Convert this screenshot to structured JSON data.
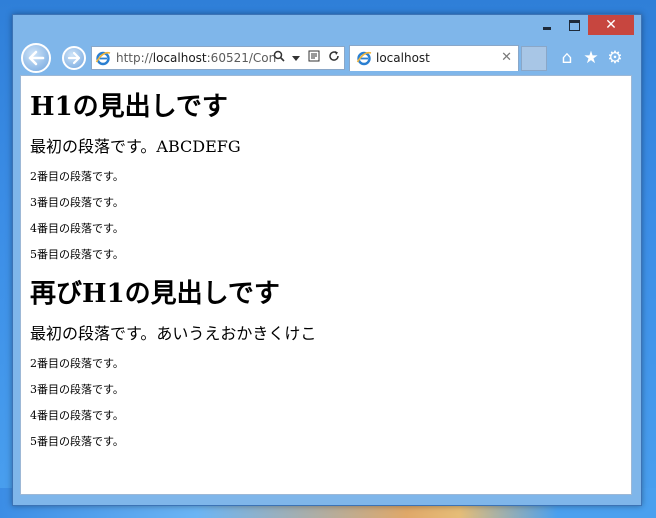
{
  "window": {
    "minimize_label": "",
    "maximize_label": "",
    "close_label": "✕"
  },
  "toolbar": {
    "address_prefix": "http://",
    "address_host": "localhost",
    "address_rest": ":60521/Con",
    "tab_title": "localhost",
    "tab_close": "✕",
    "home_icon": "⌂",
    "favorites_icon": "★",
    "settings_icon": "⚙"
  },
  "content": {
    "sections": [
      {
        "heading": "H1の見出しです",
        "lead": "最初の段落です。ABCDEFG",
        "paragraphs": [
          "2番目の段落です。",
          "3番目の段落です。",
          "4番目の段落です。",
          "5番目の段落です。"
        ]
      },
      {
        "heading": "再びH1の見出しです",
        "lead": "最初の段落です。あいうえおかきくけこ",
        "paragraphs": [
          "2番目の段落です。",
          "3番目の段落です。",
          "4番目の段落です。",
          "5番目の段落です。"
        ]
      }
    ]
  },
  "colors": {
    "close_button": "#c7463f",
    "frame": "#7fb6ea",
    "desktop": "#3b8de6"
  }
}
